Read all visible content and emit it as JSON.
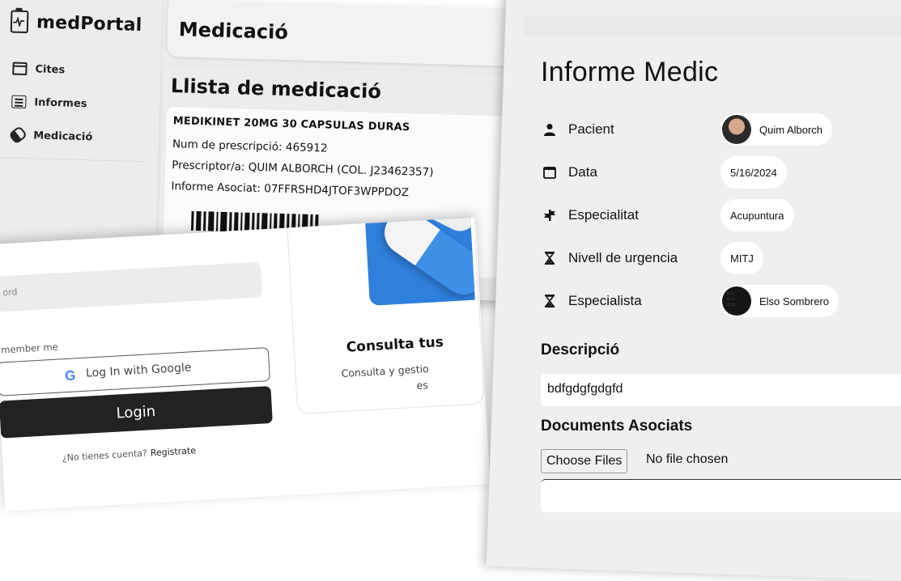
{
  "app": {
    "name": "medPortal"
  },
  "sidebar": {
    "items": [
      {
        "label": "Cites",
        "icon": "calendar-icon"
      },
      {
        "label": "Informes",
        "icon": "report-icon"
      },
      {
        "label": "Medicació",
        "icon": "pill-icon"
      }
    ]
  },
  "medication": {
    "header_title": "Medicació",
    "list_title": "Llista de medicació",
    "card": {
      "name": "MEDIKINET 20MG 30 CAPSULAS DURAS",
      "prescription_label": "Num de prescripció:",
      "prescription_value": "465912",
      "prescriber_label": "Prescriptor/a:",
      "prescriber_value": "QUIM ALBORCH (COL. J23462357)",
      "report_label": "Informe Asociat:",
      "report_value": "07FFRSHD4JTOF3WPPDOZ"
    }
  },
  "login": {
    "password_placeholder": "ord",
    "remember_label": "member me",
    "google_button": "Log In with Google",
    "google_logo": "G",
    "login_button": "Login",
    "signup_prompt": "¿No tienes cuenta?",
    "signup_link": "Registrate",
    "promo_title": "Consulta tus",
    "promo_sub": "Consulta y gestio",
    "promo_sub2": "es"
  },
  "report": {
    "title": "Informe Medic",
    "fields": [
      {
        "label": "Pacient",
        "value": "Quim Alborch",
        "icon": "person-icon"
      },
      {
        "label": "Data",
        "value": "5/16/2024",
        "icon": "calendar-icon"
      },
      {
        "label": "Especialitat",
        "value": "Acupuntura",
        "icon": "signpost-icon"
      },
      {
        "label": "Nivell de urgencia",
        "value": "MITJ",
        "icon": "hourglass-icon"
      },
      {
        "label": "Especialista",
        "value": "Elso Sombrero",
        "icon": "hourglass-icon"
      }
    ],
    "description_heading": "Descripció",
    "description_value": "bdfgdgfgdgfd",
    "documents_heading": "Documents Asociats",
    "file_button": "Choose Files",
    "file_status": "No file chosen"
  }
}
